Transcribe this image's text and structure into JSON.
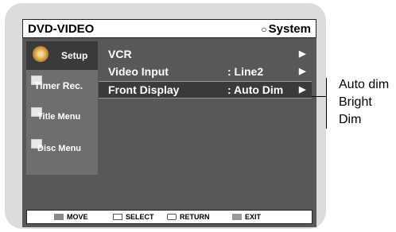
{
  "header": {
    "left_title": "DVD-VIDEO",
    "right_title": "System",
    "right_icon": "circle-icon"
  },
  "sidebar": {
    "items": [
      {
        "label": "Setup",
        "icon": "gear-icon",
        "active": true
      },
      {
        "label": "Timer Rec.",
        "icon": "timer-icon",
        "active": false
      },
      {
        "label": "Title Menu",
        "icon": "title-menu-icon",
        "active": false
      },
      {
        "label": "Disc Menu",
        "icon": "disc-menu-icon",
        "active": false
      }
    ]
  },
  "menu": {
    "rows": [
      {
        "label": "VCR",
        "value": "",
        "arrow": "▶"
      },
      {
        "label": "Video Input",
        "value": ": Line2",
        "arrow": "▶"
      },
      {
        "label": "Front Display",
        "value": ": Auto Dim",
        "arrow": "▶",
        "selected": true
      }
    ]
  },
  "footer": {
    "move": "MOVE",
    "select": "SELECT",
    "return": "RETURN",
    "exit": "EXIT"
  },
  "options": [
    "Auto dim",
    "Bright",
    "Dim"
  ],
  "colors": {
    "screen_bg": "#58585a",
    "sidebar_bg": "#6e6e70",
    "selected_bg": "#3a3a3c"
  }
}
